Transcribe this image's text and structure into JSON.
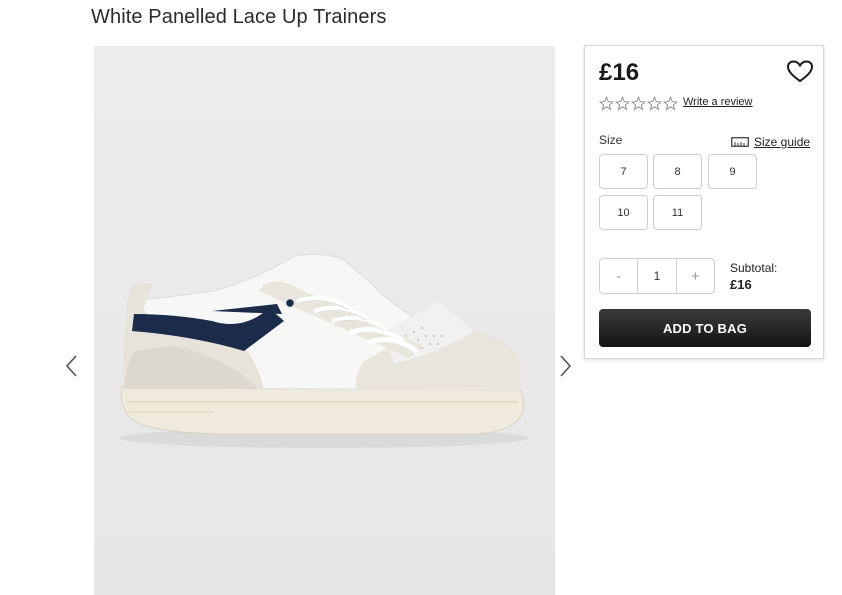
{
  "product": {
    "title": "White Panelled Lace Up Trainers",
    "price": "£16",
    "review_link": "Write a review",
    "rating_stars": 0,
    "image_alt": "White panelled lace up trainer with navy panel"
  },
  "sizes": {
    "label": "Size",
    "guide_label": "Size guide",
    "options": [
      "7",
      "8",
      "9",
      "10",
      "11"
    ]
  },
  "quantity": {
    "minus": "-",
    "value": "1",
    "plus": "+"
  },
  "subtotal": {
    "label": "Subtotal:",
    "value": "£16"
  },
  "actions": {
    "add_to_bag": "ADD TO BAG"
  },
  "colors": {
    "button_dark": "#1f1f1f",
    "accent_navy": "#1c2b4a",
    "border": "#cfcfcf"
  },
  "icons": {
    "prev": "chevron-left-icon",
    "next": "chevron-right-icon",
    "wishlist": "heart-icon",
    "size_guide": "ruler-icon",
    "star": "star-outline-icon"
  }
}
